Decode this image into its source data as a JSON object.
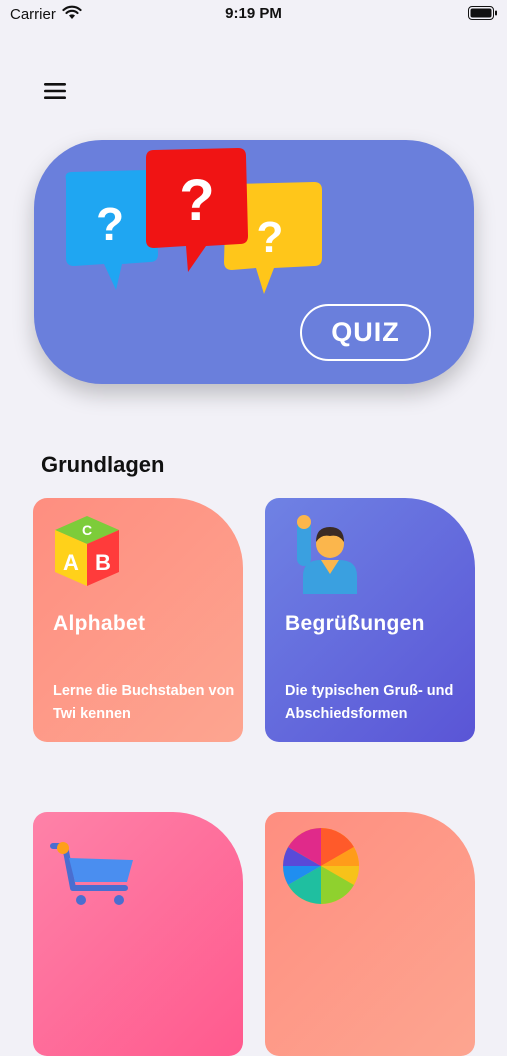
{
  "status_bar": {
    "carrier": "Carrier",
    "time": "9:19 PM"
  },
  "banner": {
    "quiz_label": "QUIZ"
  },
  "section": {
    "title": "Grundlagen"
  },
  "cards": [
    {
      "title": "Alphabet",
      "description": "Lerne die Buchstaben von Twi kennen"
    },
    {
      "title": "Begrüßungen",
      "description": "Die typischen Gruß- und Abschiedsformen"
    }
  ],
  "colors": {
    "background": "#f2f1f7",
    "quiz_banner": "#6a7fdc",
    "card_coral": "#fe8e80",
    "card_indigo": "#6f82e4",
    "card_pink": "#ff5a8e"
  },
  "icons": {
    "menu": "hamburger-menu-icon",
    "bubbles": "question-speech-bubbles-icon",
    "alphabet": "abc-blocks-icon",
    "greetings": "waving-person-icon",
    "shopping": "shopping-cart-icon",
    "colors": "color-wheel-icon"
  }
}
